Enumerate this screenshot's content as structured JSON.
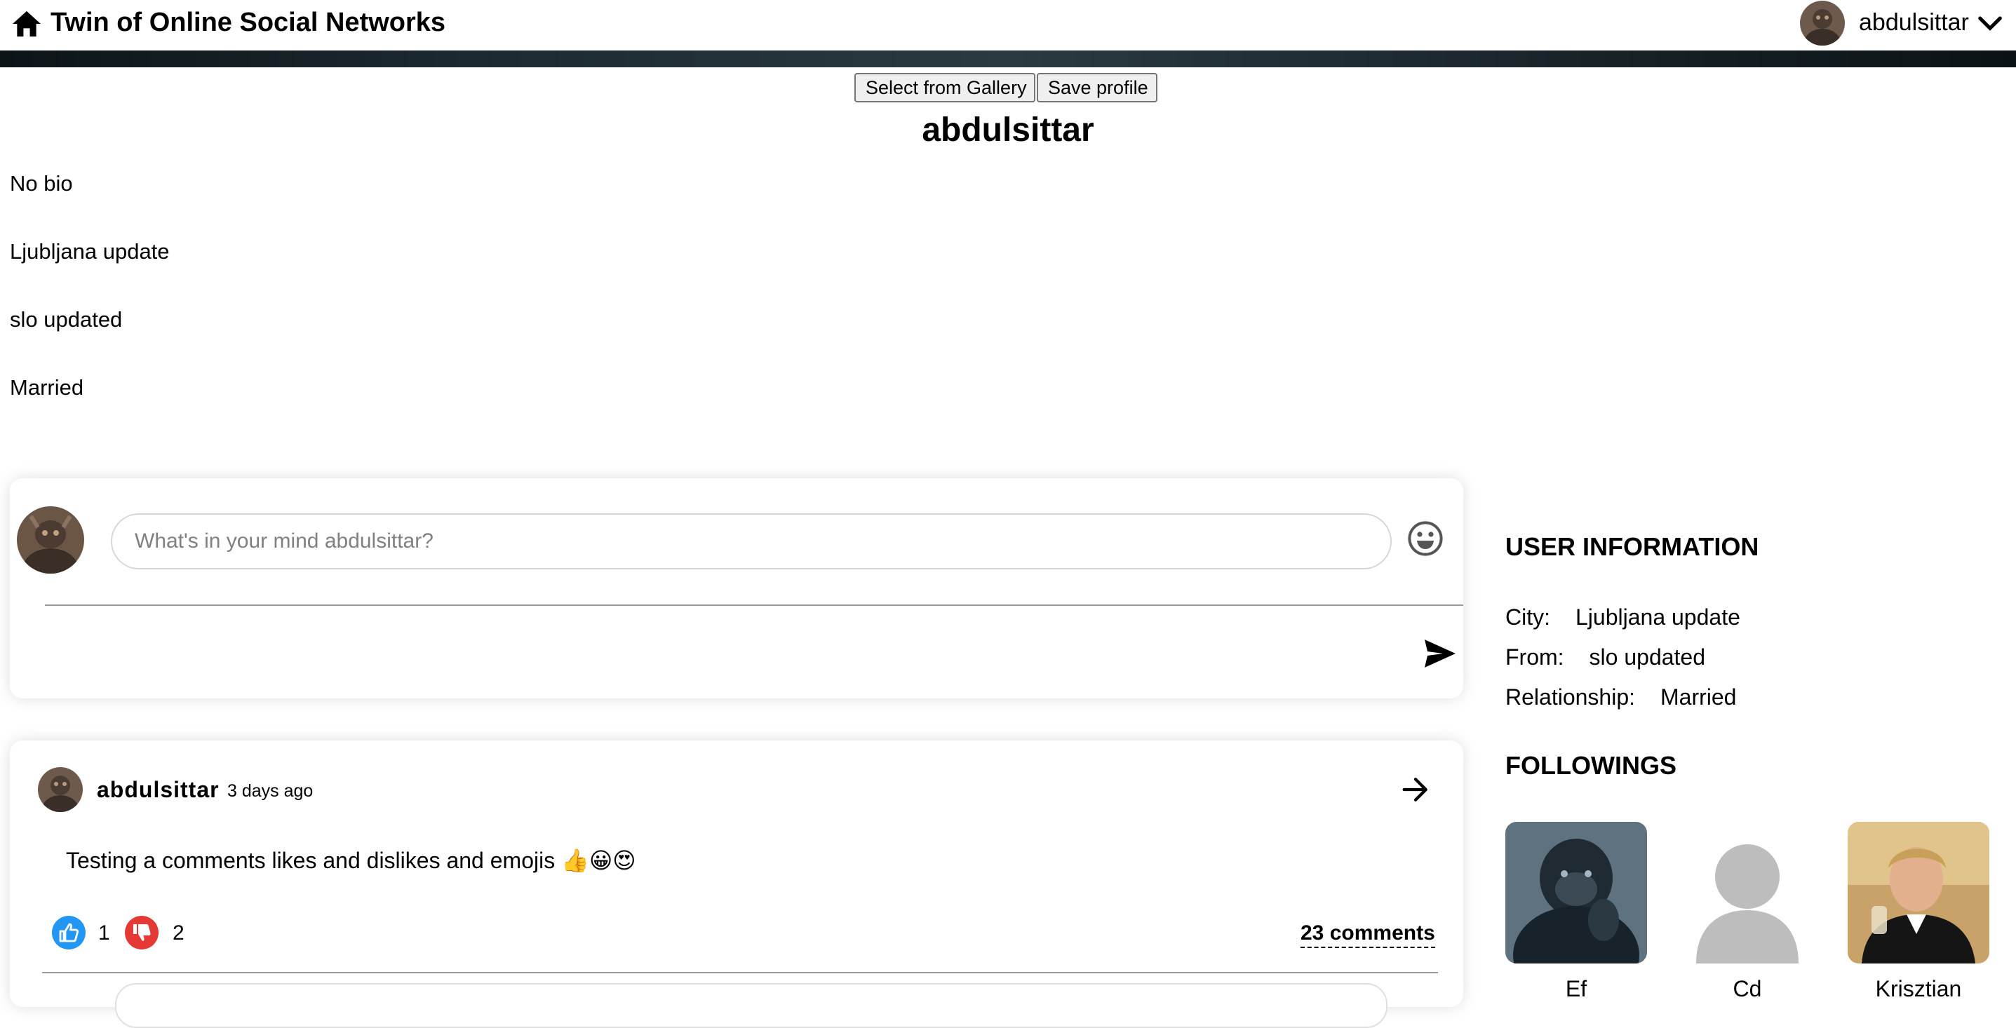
{
  "header": {
    "title": "Twin of Online Social Networks",
    "username": "abdulsittar",
    "home_icon": "home-icon",
    "menu_icon": "chevron-down-icon"
  },
  "profile": {
    "select_gallery_label": "Select from Gallery",
    "save_profile_label": "Save profile",
    "name": "abdulsittar",
    "bio": "No bio",
    "city": "Ljubljana update",
    "from": "slo updated",
    "relationship": "Married"
  },
  "composer": {
    "placeholder": "What's in your mind abdulsittar?",
    "emoji_icon": "emoji-icon",
    "send_icon": "send-icon"
  },
  "post": {
    "author": "abdulsittar",
    "time": "3 days ago",
    "text": "Testing a comments likes and dislikes and emojis 👍😀😍",
    "likes": "1",
    "dislikes": "2",
    "comments": "23 comments"
  },
  "sidebar": {
    "user_info_title": "USER INFORMATION",
    "city_label": "City:",
    "city": "Ljubljana update",
    "from_label": "From:",
    "from": "slo updated",
    "relationship_label": "Relationship:",
    "relationship": "Married",
    "followings_title": "FOLLOWINGS",
    "followings": [
      {
        "name": "Ef"
      },
      {
        "name": "Cd"
      },
      {
        "name": "Krisztian"
      }
    ]
  },
  "colors": {
    "like": "#2196f3",
    "dislike": "#e53935",
    "banner": "#1d2b31"
  }
}
